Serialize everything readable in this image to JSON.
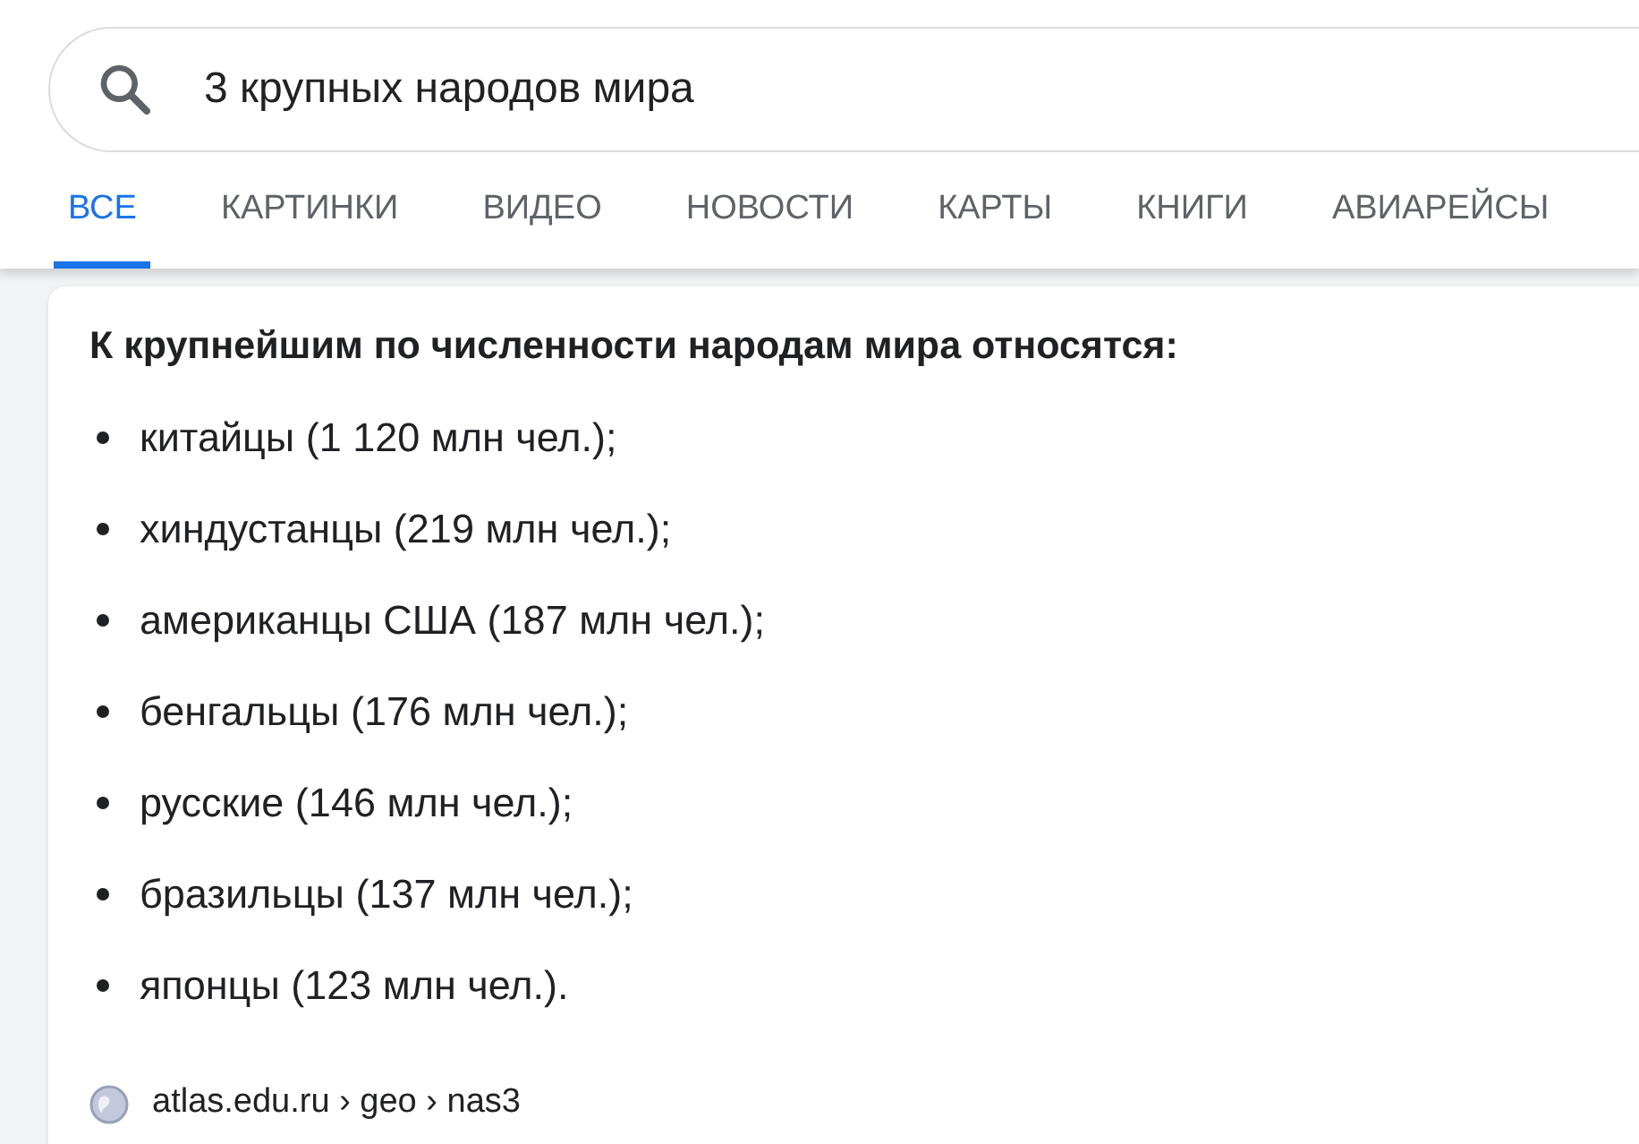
{
  "search": {
    "query": "3 крупных народов мира"
  },
  "tabs": [
    {
      "label": "ВСЕ",
      "selected": true
    },
    {
      "label": "КАРТИНКИ",
      "selected": false
    },
    {
      "label": "ВИДЕО",
      "selected": false
    },
    {
      "label": "НОВОСТИ",
      "selected": false
    },
    {
      "label": "КАРТЫ",
      "selected": false
    },
    {
      "label": "КНИГИ",
      "selected": false
    },
    {
      "label": "АВИАРЕЙСЫ",
      "selected": false
    }
  ],
  "snippet": {
    "heading": "К крупнейшим по численности народам мира относятся:",
    "items": [
      "китайцы (1 120 млн чел.);",
      "хиндустанцы (219 млн чел.);",
      "американцы США (187 млн чел.);",
      "бенгальцы (176 млн чел.);",
      "русские (146 млн чел.);",
      "бразильцы (137 млн чел.);",
      "японцы (123 млн чел.)."
    ],
    "source": "atlas.edu.ru › geo › nas3"
  }
}
